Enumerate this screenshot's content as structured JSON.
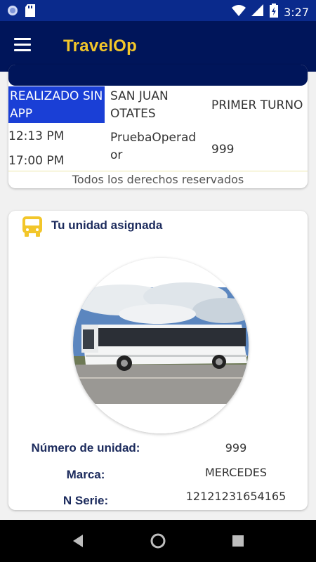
{
  "status_bar": {
    "time": "3:27"
  },
  "app": {
    "title": "TravelOp"
  },
  "trip": {
    "status": "REALIZADO SIN APP",
    "route": "SAN JUAN OTATES",
    "shift": "PRIMER TURNO",
    "time_start": "12:13 PM",
    "time_end": "17:00 PM",
    "operator": "PruebaOperador",
    "unit": "999",
    "footer": "Todos los derechos reservados"
  },
  "assigned_unit": {
    "title": "Tu unidad asignada",
    "labels": {
      "number": "Número de unidad:",
      "brand": "Marca:",
      "serial": "N Serie:"
    },
    "values": {
      "number": "999",
      "brand": "MERCEDES",
      "serial": "12121231654165"
    }
  },
  "colors": {
    "primary": "#00155a",
    "accent": "#f2c62a",
    "status_chip": "#1a3fd6"
  }
}
